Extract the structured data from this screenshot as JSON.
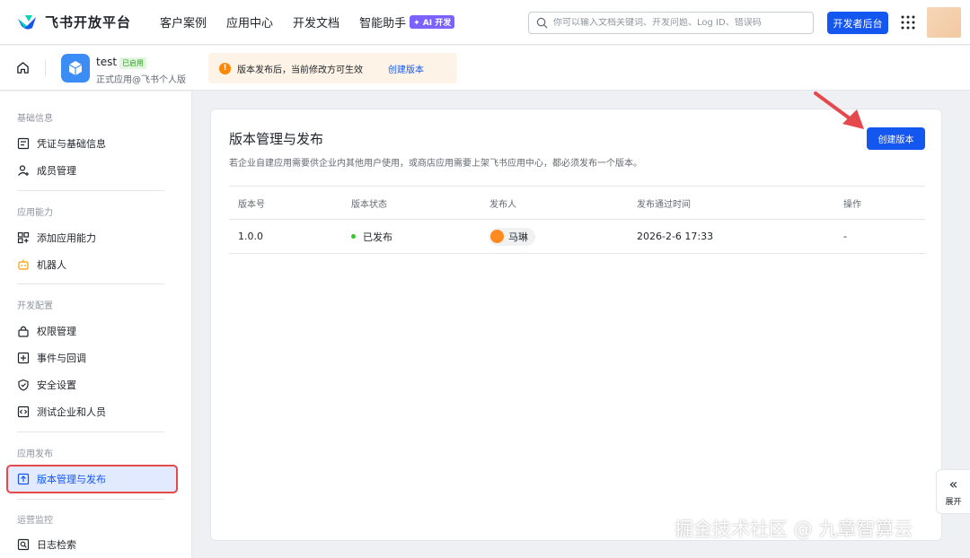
{
  "topnav": {
    "brand": "飞书开放平台",
    "links": [
      "客户案例",
      "应用中心",
      "开发文档",
      "智能助手"
    ],
    "ai_badge": "✦ AI 开发",
    "search_placeholder": "你可以输入文档关键词、开发问题、Log ID、错误码",
    "dev_console_label": "开发者后台"
  },
  "appbar": {
    "app_name": "test",
    "app_status_badge": "已启用",
    "app_subtitle": "正式应用@飞书个人版",
    "notice_text": "版本发布后，当前修改方可生效",
    "notice_link": "创建版本"
  },
  "sidebar": {
    "sections": [
      {
        "title": "基础信息",
        "items": [
          "凭证与基础信息",
          "成员管理"
        ]
      },
      {
        "title": "应用能力",
        "items": [
          "添加应用能力",
          "机器人"
        ]
      },
      {
        "title": "开发配置",
        "items": [
          "权限管理",
          "事件与回调",
          "安全设置",
          "测试企业和人员"
        ]
      },
      {
        "title": "应用发布",
        "items": [
          "版本管理与发布"
        ]
      },
      {
        "title": "运营监控",
        "items": [
          "日志检索"
        ]
      }
    ]
  },
  "main": {
    "title": "版本管理与发布",
    "description": "若企业自建应用需要供企业内其他用户使用，或商店应用需要上架飞书应用中心，都必须发布一个版本。",
    "create_button": "创建版本",
    "table": {
      "headers": [
        "版本号",
        "版本状态",
        "发布人",
        "发布通过时间",
        "操作"
      ],
      "rows": [
        {
          "version": "1.0.0",
          "status": "已发布",
          "publisher": "马琳",
          "time": "2026-2-6 17:33",
          "action": "-"
        }
      ]
    }
  },
  "expand_label": "展开",
  "watermark": "掘金技术社区 @ 九章智算云",
  "colors": {
    "primary": "#1456f0",
    "active_bg": "#e1eaff",
    "highlight_border": "#e5484d",
    "warning": "#ff8800",
    "success": "#34c724"
  }
}
